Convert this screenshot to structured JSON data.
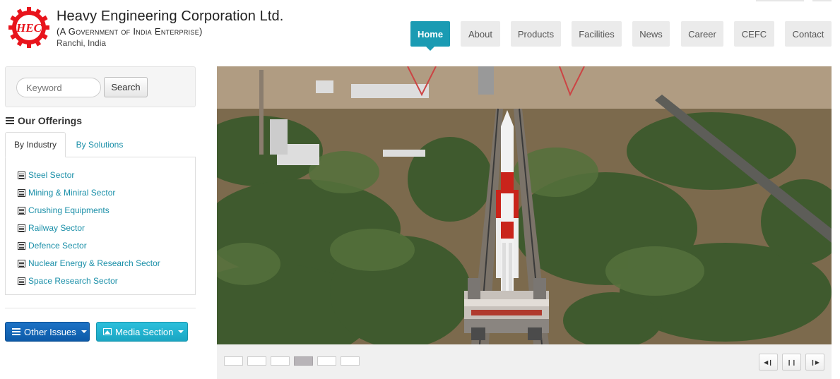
{
  "brand": {
    "logo_text": "HEC",
    "title": "Heavy Engineering Corporation Ltd.",
    "subtitle": "(A Government of India Enterprise)",
    "location": "Ranchi, India",
    "logo_color": "#e8141c"
  },
  "nav": {
    "items": [
      {
        "label": "Home",
        "active": true
      },
      {
        "label": "About",
        "active": false
      },
      {
        "label": "Products",
        "active": false
      },
      {
        "label": "Facilities",
        "active": false
      },
      {
        "label": "News",
        "active": false
      },
      {
        "label": "Career",
        "active": false
      },
      {
        "label": "CEFC",
        "active": false
      },
      {
        "label": "Contact",
        "active": false
      }
    ],
    "accent": "#1a9bb3"
  },
  "search": {
    "placeholder": "Keyword",
    "button_label": "Search"
  },
  "offerings": {
    "heading": "Our Offerings",
    "tabs": [
      "By Industry",
      "By Solutions"
    ],
    "active_tab": "By Industry",
    "sectors": [
      "Steel Sector",
      "Mining & Miniral Sector",
      "Crushing Equipments",
      "Railway Sector",
      "Defence Sector",
      "Nuclear Energy & Research Sector",
      "Space Research Sector"
    ],
    "link_color": "#1a8fa8"
  },
  "actions": {
    "other_issues": "Other Issues",
    "media_section": "Media Section"
  },
  "slider": {
    "image_desc_icon": "rocket-launch-image",
    "slide_count": 6,
    "active_slide": 4,
    "controls": [
      "prev-icon",
      "pause-icon",
      "next-icon"
    ]
  }
}
